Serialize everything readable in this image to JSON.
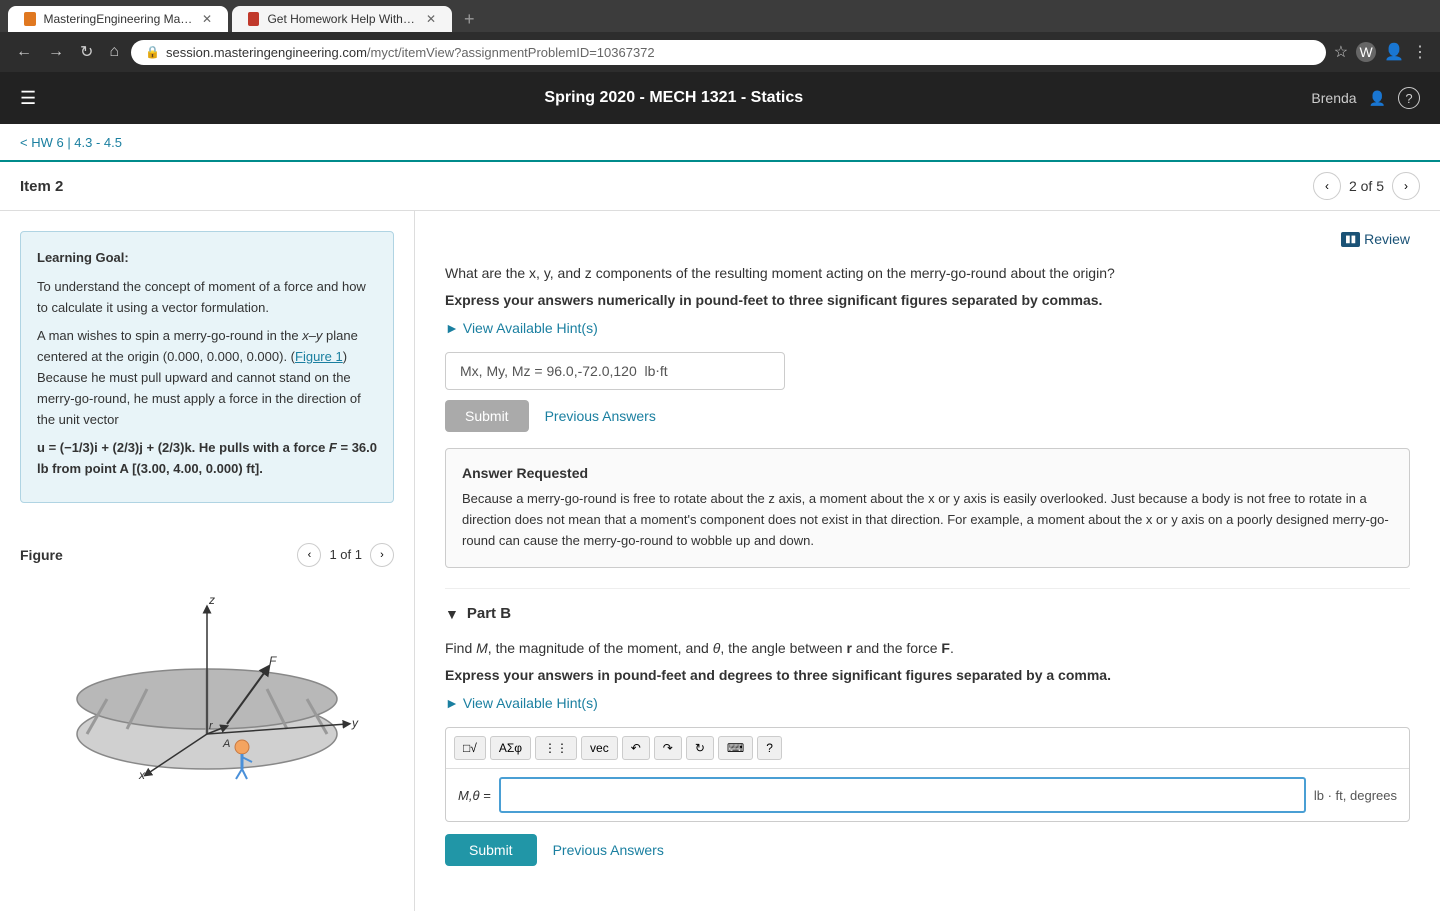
{
  "browser": {
    "tabs": [
      {
        "id": "tab1",
        "label": "MasteringEngineering Mastering...",
        "active": true,
        "favicon_color": "#e07820"
      },
      {
        "id": "tab2",
        "label": "Get Homework Help With Chegg...",
        "active": false,
        "favicon_color": "#c0392b"
      }
    ],
    "url_base": "session.masteringengineering.com",
    "url_path": "/myct/itemView?assignmentProblemID=10367372"
  },
  "header": {
    "title": "Spring 2020 - MECH 1321 - Statics",
    "user": "Brenda"
  },
  "breadcrumb": {
    "text": "< HW 6 | 4.3 - 4.5"
  },
  "item": {
    "title": "Item 2",
    "pagination": "2 of 5"
  },
  "left_panel": {
    "learning_goal_title": "Learning Goal:",
    "learning_goal_text": "To understand the concept of moment of a force and how to calculate it using a vector formulation.",
    "problem_text1": "A man wishes to spin a merry-go-round in the x–y plane centered at the origin (0.000, 0.000, 0.000). (Figure 1) Because he must pull upward and cannot stand on the merry-go-round, he must apply a force in the direction of the unit vector",
    "unit_vector": "u = (−1/3)i + (2/3)j + (2/3)k.",
    "problem_text2": "He pulls with a force F = 36.0 lb from point A [(3.00, 4.00, 0.000) ft].",
    "figure_title": "Figure",
    "figure_nav": "1 of 1"
  },
  "right_panel": {
    "review_label": "Review",
    "question_text": "What are the x, y, and z components of the resulting moment acting on the merry-go-round about the origin?",
    "instruction_text": "Express your answers numerically in pound-feet to three significant figures separated by commas.",
    "hint_label": "View Available Hint(s)",
    "answer_value": "Mx, My, Mz = 96.0,-72.0,120  lb⋅ft",
    "answer_placeholder": "Mx, My, Mz =  lb · ft",
    "submit_disabled_label": "Submit",
    "prev_answers_label": "Previous Answers",
    "answer_requested_title": "Answer Requested",
    "answer_requested_text": "Because a merry-go-round is free to rotate about the z axis, a moment about the x or y axis is easily overlooked. Just because a body is not free to rotate in a direction does not mean that a moment's component does not exist in that direction. For example, a moment about the x or y axis on a poorly designed merry-go-round can cause the merry-go-round to wobble up and down.",
    "part_b_title": "Part B",
    "part_b_question": "Find M, the magnitude of the moment, and θ, the angle between r and the force F.",
    "part_b_instruction": "Express your answers in pound-feet and degrees to three significant figures separated by a comma.",
    "part_b_hint_label": "View Available Hint(s)",
    "part_b_label": "M,θ =",
    "part_b_unit": "lb · ft, degrees",
    "part_b_submit_label": "Submit",
    "part_b_prev_label": "Previous Answers",
    "toolbar_buttons": [
      "matrix",
      "AΣφ",
      "format",
      "vec",
      "undo",
      "redo",
      "refresh",
      "keyboard",
      "help"
    ]
  }
}
